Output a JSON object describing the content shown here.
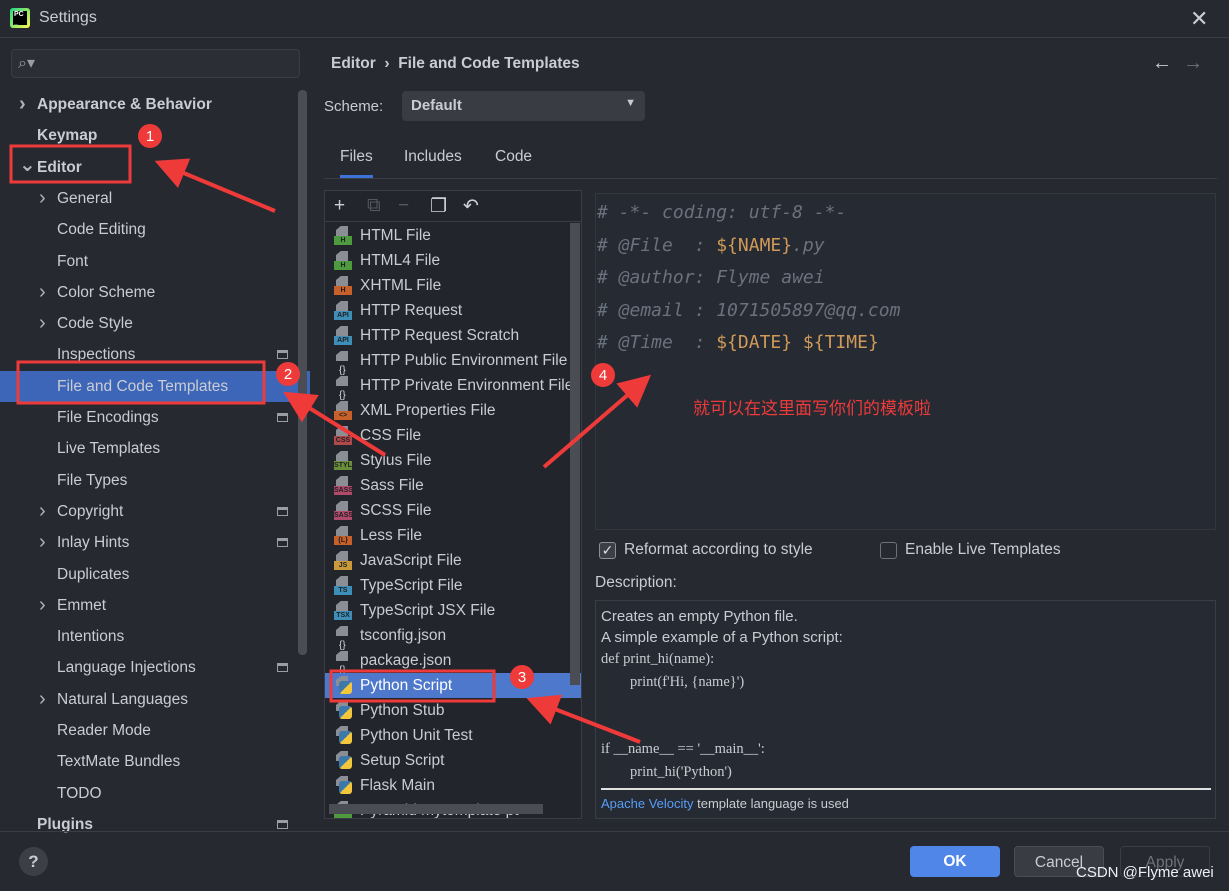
{
  "window": {
    "title": "Settings",
    "close_icon": "close-icon"
  },
  "search": {
    "placeholder": ""
  },
  "sidebar": {
    "items": [
      {
        "label": "Appearance & Behavior",
        "bold": true,
        "chevron": ">",
        "indent": 0
      },
      {
        "label": "Keymap",
        "bold": true,
        "chevron": "",
        "indent": 0
      },
      {
        "label": "Editor",
        "bold": true,
        "chevron": "v",
        "indent": 0
      },
      {
        "label": "General",
        "chevron": ">",
        "indent": 1
      },
      {
        "label": "Code Editing",
        "chevron": "",
        "indent": 1
      },
      {
        "label": "Font",
        "chevron": "",
        "indent": 1
      },
      {
        "label": "Color Scheme",
        "chevron": ">",
        "indent": 1
      },
      {
        "label": "Code Style",
        "chevron": ">",
        "indent": 1
      },
      {
        "label": "Inspections",
        "chevron": "",
        "indent": 1,
        "project": true
      },
      {
        "label": "File and Code Templates",
        "chevron": "",
        "indent": 1,
        "selected": true
      },
      {
        "label": "File Encodings",
        "chevron": "",
        "indent": 1,
        "project": true
      },
      {
        "label": "Live Templates",
        "chevron": "",
        "indent": 1
      },
      {
        "label": "File Types",
        "chevron": "",
        "indent": 1
      },
      {
        "label": "Copyright",
        "chevron": ">",
        "indent": 1,
        "project": true
      },
      {
        "label": "Inlay Hints",
        "chevron": ">",
        "indent": 1,
        "project": true
      },
      {
        "label": "Duplicates",
        "chevron": "",
        "indent": 1
      },
      {
        "label": "Emmet",
        "chevron": ">",
        "indent": 1
      },
      {
        "label": "Intentions",
        "chevron": "",
        "indent": 1
      },
      {
        "label": "Language Injections",
        "chevron": "",
        "indent": 1,
        "project": true
      },
      {
        "label": "Natural Languages",
        "chevron": ">",
        "indent": 1
      },
      {
        "label": "Reader Mode",
        "chevron": "",
        "indent": 1
      },
      {
        "label": "TextMate Bundles",
        "chevron": "",
        "indent": 1
      },
      {
        "label": "TODO",
        "chevron": "",
        "indent": 1
      },
      {
        "label": "Plugins",
        "bold": true,
        "chevron": "",
        "indent": 0,
        "project": true
      }
    ]
  },
  "breadcrumb": {
    "parent": "Editor",
    "separator": "›",
    "current": "File and Code Templates",
    "back": "←",
    "forward": "→"
  },
  "scheme": {
    "label": "Scheme:",
    "value": "Default"
  },
  "tabs": [
    {
      "label": "Files",
      "active": true
    },
    {
      "label": "Includes"
    },
    {
      "label": "Code"
    }
  ],
  "toolbar": {
    "add": "+",
    "copy_disabled": "⧉",
    "remove": "−",
    "duplicate": "❐",
    "reset": "↶"
  },
  "templates": [
    {
      "label": "HTML File",
      "badge": "H",
      "color": "#4e9a3e"
    },
    {
      "label": "HTML4 File",
      "badge": "H",
      "color": "#4e9a3e"
    },
    {
      "label": "XHTML File",
      "badge": "H",
      "color": "#c8602a"
    },
    {
      "label": "HTTP Request",
      "badge": "API",
      "color": "#3d8fb8"
    },
    {
      "label": "HTTP Request Scratch",
      "badge": "API",
      "color": "#3d8fb8"
    },
    {
      "label": "HTTP Public Environment File",
      "badge": "{}",
      "color": ""
    },
    {
      "label": "HTTP Private Environment File",
      "badge": "{}",
      "color": ""
    },
    {
      "label": "XML Properties File",
      "badge": "<>",
      "color": "#c8602a"
    },
    {
      "label": "CSS File",
      "badge": "CSS",
      "color": "#b04a4a"
    },
    {
      "label": "Stylus File",
      "badge": "STYL",
      "color": "#6b8e3a"
    },
    {
      "label": "Sass File",
      "badge": "SASS",
      "color": "#b04a6a"
    },
    {
      "label": "SCSS File",
      "badge": "SASS",
      "color": "#b04a6a"
    },
    {
      "label": "Less File",
      "badge": "{L}",
      "color": "#c8602a"
    },
    {
      "label": "JavaScript File",
      "badge": "JS",
      "color": "#c89a3a"
    },
    {
      "label": "TypeScript File",
      "badge": "TS",
      "color": "#3d8fb8"
    },
    {
      "label": "TypeScript JSX File",
      "badge": "TSX",
      "color": "#3d8fb8"
    },
    {
      "label": "tsconfig.json",
      "badge": "{}",
      "color": ""
    },
    {
      "label": "package.json",
      "badge": "{}",
      "color": ""
    },
    {
      "label": "Python Script",
      "badge": "py",
      "color": "",
      "selected": true
    },
    {
      "label": "Python Stub",
      "badge": "py",
      "color": ""
    },
    {
      "label": "Python Unit Test",
      "badge": "py",
      "color": ""
    },
    {
      "label": "Setup Script",
      "badge": "py",
      "color": ""
    },
    {
      "label": "Flask Main",
      "badge": "py",
      "color": ""
    },
    {
      "label": "Pyramid mytemplate pt",
      "badge": "",
      "color": "#4e9a3e"
    }
  ],
  "editor": {
    "lines": [
      [
        {
          "t": "# -*- coding: utf-8 -*-"
        }
      ],
      [
        {
          "t": "# @File  : "
        },
        {
          "t": "${NAME}",
          "v": true
        },
        {
          "t": ".py"
        }
      ],
      [
        {
          "t": "# @author: Flyme awei"
        }
      ],
      [
        {
          "t": "# @email : 1071505897@qq.com"
        }
      ],
      [
        {
          "t": "# @Time  : "
        },
        {
          "t": "${DATE}",
          "v": true
        },
        {
          "t": " "
        },
        {
          "t": "${TIME}",
          "v": true
        }
      ]
    ]
  },
  "options": {
    "reformat": {
      "label": "Reformat according to style",
      "checked": true
    },
    "live": {
      "label": "Enable Live Templates",
      "checked": false
    }
  },
  "description": {
    "label": "Description:",
    "line1": "Creates an empty Python file.",
    "line2": "A simple example of a Python script:",
    "code": "def print_hi(name):\n        print(f'Hi, {name}')\n\n\nif __name__ == '__main__':\n        print_hi('Python')",
    "velocity_link": "Apache Velocity",
    "velocity_text": " template language is used"
  },
  "buttons": {
    "help": "?",
    "ok": "OK",
    "cancel": "Cancel",
    "apply": "Apply"
  },
  "annotations": {
    "markers": [
      "1",
      "2",
      "3",
      "4"
    ],
    "note": "就可以在这里面写你们的模板啦",
    "color": "#ef3a3a"
  },
  "watermark": "CSDN @Flyme awei"
}
